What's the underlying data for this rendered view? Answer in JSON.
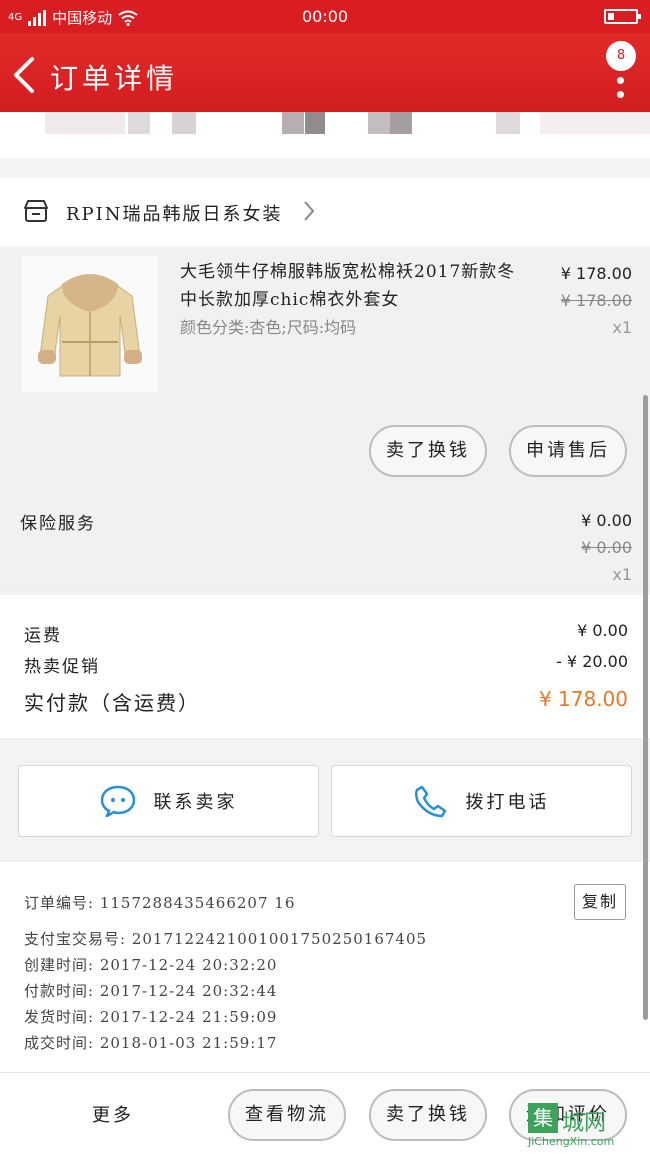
{
  "status_bar": {
    "network": "4G",
    "carrier": "中国移动",
    "time": "00:00"
  },
  "header": {
    "title": "订单详情",
    "badge": "8"
  },
  "shop": {
    "name": "RPIN瑞品韩版日系女装"
  },
  "product": {
    "title": "大毛领牛仔棉服韩版宽松棉袄2017新款冬中长款加厚chic棉衣外套女",
    "attrs": "颜色分类:杏色;尺码:均码",
    "price": "¥ 178.00",
    "original_price": "¥ 178.00",
    "qty": "x1",
    "btn_refund": "卖了换钱",
    "btn_after_sale": "申请售后"
  },
  "insurance": {
    "label": "保险服务",
    "price": "¥ 0.00",
    "original_price": "¥ 0.00",
    "qty": "x1"
  },
  "summary": {
    "shipping_label": "运费",
    "shipping_value": "¥ 0.00",
    "promo_label": "热卖促销",
    "promo_value": "- ¥ 20.00",
    "total_label": "实付款（含运费）",
    "total_value": "¥ 178.00"
  },
  "contact": {
    "seller_label": "联系卖家",
    "phone_label": "拨打电话"
  },
  "order_info": {
    "order_no": "订单编号: 1157288435466207 16",
    "alipay_no": "支付宝交易号: 2017122421001001750250167405",
    "created": "创建时间: 2017-12-24 20:32:20",
    "paid": "付款时间: 2017-12-24 20:32:44",
    "shipped": "发货时间: 2017-12-24 21:59:09",
    "completed": "成交时间: 2018-01-03 21:59:17",
    "copy_label": "复制"
  },
  "bottom_bar": {
    "more": "更多",
    "logistics": "查看物流",
    "sell": "卖了换钱",
    "review": "追加评价"
  },
  "watermark": {
    "logo": "集",
    "text": "城网",
    "url": "JiChengXin.com"
  },
  "colors": {
    "brand_red": "#d81e22",
    "total_orange": "#e4792c",
    "contact_blue": "#2a8fd6"
  }
}
